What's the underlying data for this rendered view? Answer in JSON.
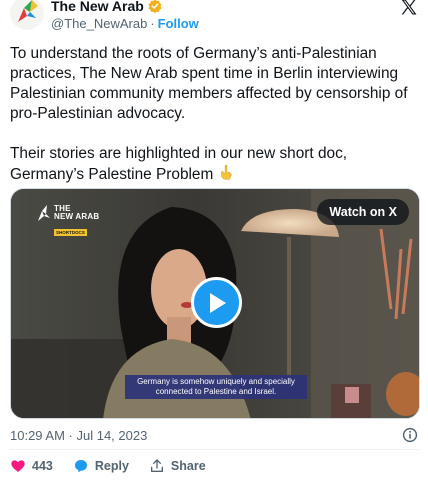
{
  "author": {
    "display_name": "The New Arab",
    "handle": "@The_NewArab",
    "separator": "·",
    "follow_label": "Follow",
    "verified_color": "#f2b01e"
  },
  "tweet": {
    "text": "To understand the roots of Germany’s anti-Palestinian practices, The New Arab spent time in Berlin interviewing Palestinian community members affected by censorship of pro-Palestinian advocacy.\n\nTheir stories are highlighted in our new short doc, Germany’s Palestine Problem",
    "emoji": "backhand-index-pointing-down-icon"
  },
  "media": {
    "brand_line1": "THE",
    "brand_line2": "NEW ARAB",
    "brand_sub": "SHORTDOCS",
    "watch_label": "Watch on X",
    "subtitle": "Germany is somehow uniquely and specially connected to Palestine and Israel."
  },
  "meta": {
    "timestamp": "10:29 AM · Jul 14, 2023"
  },
  "actions": {
    "likes": "443",
    "reply_label": "Reply",
    "share_label": "Share"
  },
  "colors": {
    "accent": "#1d9bf0",
    "like": "#f91880",
    "text": "#0f1419",
    "muted": "#536471"
  }
}
